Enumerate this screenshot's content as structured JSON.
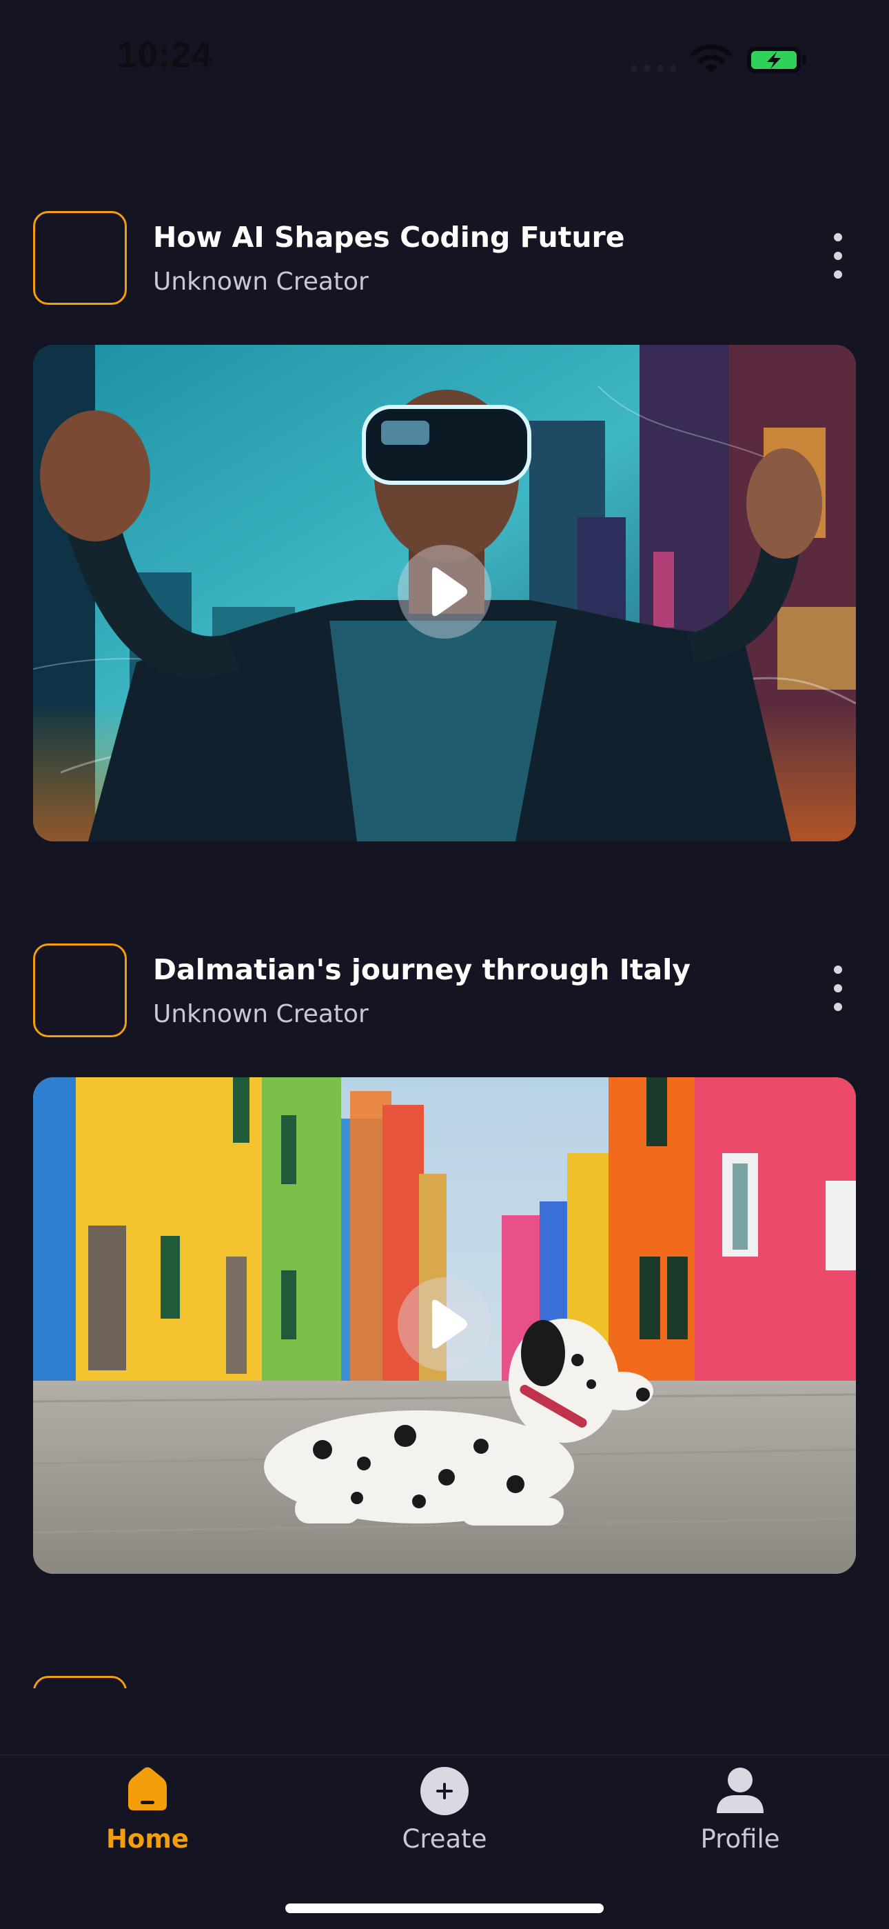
{
  "status_bar": {
    "time": "10:24",
    "icons": [
      "cellular-signal-icon",
      "wifi-icon",
      "battery-charging-icon"
    ],
    "battery_color": "#30d158"
  },
  "feed": {
    "posts": [
      {
        "title": "How AI Shapes Coding Future",
        "creator": "Unknown Creator",
        "media": "video-thumbnail-vr-headset-city"
      },
      {
        "title": "Dalmatian's journey through Italy",
        "creator": "Unknown Creator",
        "media": "video-thumbnail-dalmatian-colorful-street"
      }
    ]
  },
  "tab_bar": {
    "items": [
      {
        "label": "Home",
        "icon": "home-icon",
        "active": true
      },
      {
        "label": "Create",
        "icon": "plus-circle-icon",
        "active": false
      },
      {
        "label": "Profile",
        "icon": "person-icon",
        "active": false
      }
    ]
  },
  "colors": {
    "background": "#141422",
    "accent": "#f59e0b",
    "text_primary": "#ffffff",
    "text_secondary": "#c9c9d3"
  }
}
